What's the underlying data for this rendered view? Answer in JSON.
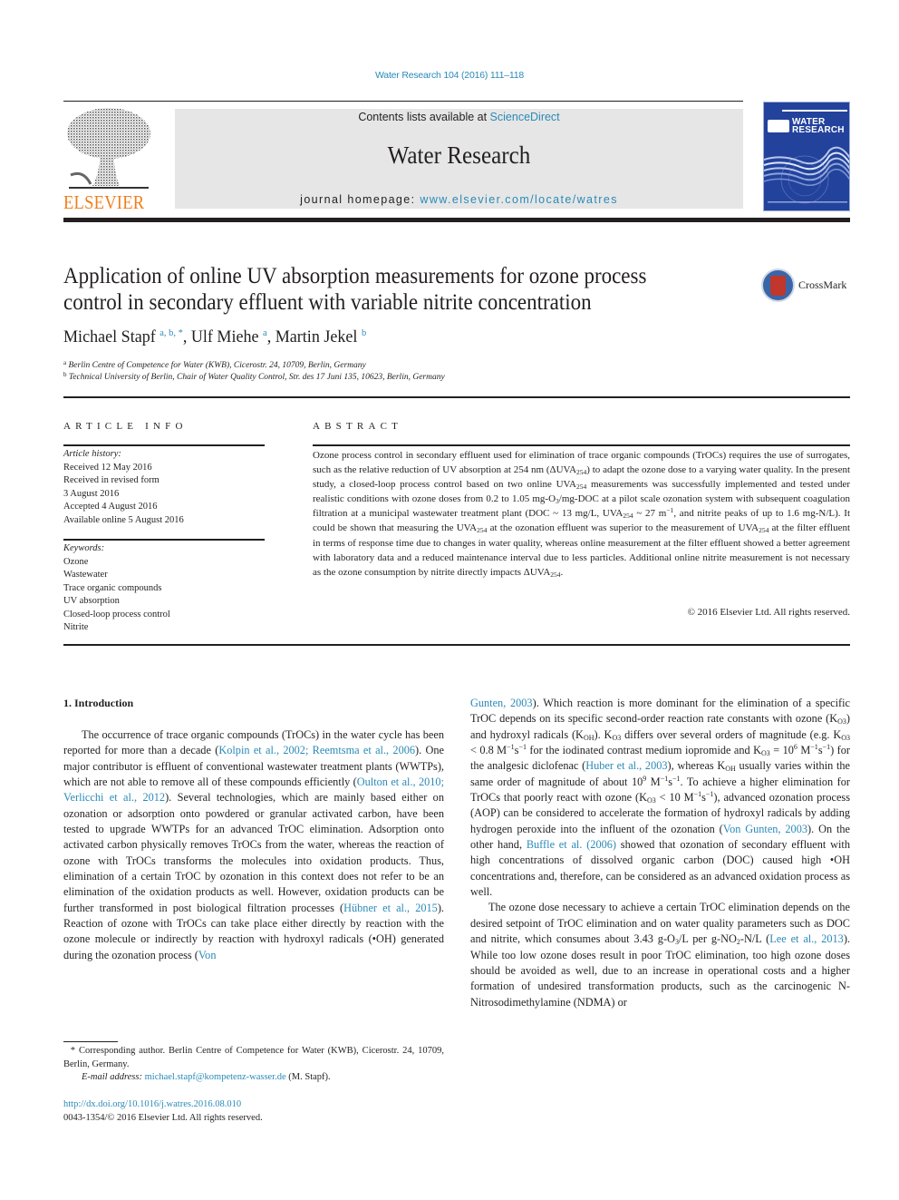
{
  "header": {
    "citation": "Water Research 104 (2016) 111–118",
    "contents_prefix": "Contents lists available at ",
    "contents_link": "ScienceDirect",
    "journal_title": "Water Research",
    "homepage_prefix": "journal homepage: ",
    "homepage_link": "www.elsevier.com/locate/watres",
    "publisher_logo": "ELSEVIER",
    "cover_title_line1": "WATER",
    "cover_title_line2": "RESEARCH",
    "colors": {
      "link": "#2a8ab8",
      "elsevier_orange": "#f07e1b",
      "cover_blue": "#23429c",
      "masthead_gray": "#e6e6e6"
    }
  },
  "article": {
    "title_line1": "Application of online UV absorption measurements for ozone process",
    "title_line2": "control in secondary effluent with variable nitrite concentration",
    "crossmark_label": "CrossMark",
    "authors": [
      {
        "name": "Michael Stapf",
        "marks": "a, b, *",
        "sep": ", "
      },
      {
        "name": "Ulf Miehe",
        "marks": "a",
        "sep": ", "
      },
      {
        "name": "Martin Jekel",
        "marks": "b",
        "sep": ""
      }
    ],
    "affiliations": [
      {
        "mark": "a",
        "text": "Berlin Centre of Competence for Water (KWB), Cicerostr. 24, 10709, Berlin, Germany"
      },
      {
        "mark": "b",
        "text": "Technical University of Berlin, Chair of Water Quality Control, Str. des 17 Juni 135, 10623, Berlin, Germany"
      }
    ]
  },
  "article_info": {
    "heading": "ARTICLE INFO",
    "history_label": "Article history:",
    "history": [
      "Received 12 May 2016",
      "Received in revised form",
      "3 August 2016",
      "Accepted 4 August 2016",
      "Available online 5 August 2016"
    ],
    "keywords_label": "Keywords:",
    "keywords": [
      "Ozone",
      "Wastewater",
      "Trace organic compounds",
      "UV absorption",
      "Closed-loop process control",
      "Nitrite"
    ]
  },
  "abstract": {
    "heading": "ABSTRACT",
    "s1": "Ozone process control in secondary effluent used for elimination of trace organic compounds (TrOCs) requires the use of surrogates, such as the relative reduction of UV absorption at 254 nm (ΔUVA",
    "sub_254": "254",
    "s2": ") to adapt the ozone dose to a varying water quality. In the present study, a closed-loop process control based on two online UVA",
    "s3": " measurements was successfully implemented and tested under realistic conditions with ozone doses from 0.2 to 1.05 mg-O",
    "sub_3": "3",
    "s4": "/mg-DOC at a pilot scale ozonation system with subsequent coagulation filtration at a municipal wastewater treatment plant (DOC ~ 13 mg/L, UVA",
    "s5": " ~ 27 m",
    "sup_minus1": "−1",
    "s6": ", and nitrite peaks of up to 1.6 mg-N/L). It could be shown that measuring the UVA",
    "s7": " at the ozonation effluent was superior to the measurement of UVA",
    "s8": " at the filter effluent in terms of response time due to changes in water quality, whereas online measurement at the filter effluent showed a better agreement with laboratory data and a reduced maintenance interval due to less particles. Additional online nitrite measurement is not necessary as the ozone consumption by nitrite directly impacts ΔUVA",
    "s9": ".",
    "copyright": "© 2016 Elsevier Ltd. All rights reserved."
  },
  "intro": {
    "heading": "1.  Introduction",
    "left": {
      "p1_a": "The occurrence of trace organic compounds (TrOCs) in the water cycle has been reported for more than a decade (",
      "ref1": "Kolpin et al., 2002; Reemtsma et al., 2006",
      "p1_b": "). One major contributor is effluent of conventional wastewater treatment plants (WWTPs), which are not able to remove all of these compounds efficiently (",
      "ref2": "Oulton et al., 2010; Verlicchi et al., 2012",
      "p1_c": "). Several technologies, which are mainly based either on ozonation or adsorption onto powdered or granular activated carbon, have been tested to upgrade WWTPs for an advanced TrOC elimination. Adsorption onto activated carbon physically removes TrOCs from the water, whereas the reaction of ozone with TrOCs transforms the molecules into oxidation products. Thus, elimination of a certain TrOC by ozonation in this context does not refer to be an elimination of the oxidation products as well. However, oxidation products can be further transformed in post biological filtration processes (",
      "ref3": "Hübner et al., 2015",
      "p1_d": "). Reaction of ozone with TrOCs can take place either directly by reaction with the ozone molecule or indirectly by reaction with hydroxyl radicals (•OH) generated during the ozonation process (",
      "ref4": "Von"
    },
    "right": {
      "ref4_cont": "Gunten, 2003",
      "p1_e": "). Which reaction is more dominant for the elimination of a specific TrOC depends on its specific second-order reaction rate constants with ozone (K",
      "sub_o3": "O3",
      "sub_oh": "OH",
      "p1_f": ") and hydroxyl radicals (K",
      "p1_g": "). K",
      "p1_h": " differs over several orders of magnitude (e.g. K",
      "p1_i": " < 0.8 M",
      "sup_m1": "−1",
      "p1_j": "s",
      "p1_k": " for the iodinated contrast medium iopromide and K",
      "p1_l": " = 10",
      "sup_6": "6",
      "p1_m": " M",
      "p1_n": ") for the analgesic diclofenac (",
      "ref5": "Huber et al., 2003",
      "p1_o": "), whereas K",
      "p1_p": " usually varies within the same order of magnitude of about 10",
      "sup_9": "9",
      "p1_q": ". To achieve a higher elimination for TrOCs that poorly react with ozone (K",
      "p1_r": " < 10 M",
      "p1_s": "), advanced ozonation process (AOP) can be considered to accelerate the formation of hydroxyl radicals by adding hydrogen peroxide into the influent of the ozonation (",
      "ref6": "Von Gunten, 2003",
      "p1_t": "). On the other hand, ",
      "ref7": "Buffle et al. (2006)",
      "p1_u": " showed that ozonation of secondary effluent with high concentrations of dissolved organic carbon (DOC) caused high •OH concentrations and, therefore, can be considered as an advanced oxidation process as well.",
      "p2_a": "The ozone dose necessary to achieve a certain TrOC elimination depends on the desired setpoint of TrOC elimination and on water quality parameters such as DOC and nitrite, which consumes about 3.43 g-O",
      "sub_3": "3",
      "p2_b": "/L per g-NO",
      "sub_2": "2",
      "p2_c": "-N/L (",
      "ref8": "Lee et al., 2013",
      "p2_d": "). While too low ozone doses result in poor TrOC elimination, too high ozone doses should be avoided as well, due to an increase in operational costs and a higher formation of undesired transformation products, such as the carcinogenic N-Nitrosodimethylamine (NDMA) or"
    }
  },
  "footnote": {
    "star": "*",
    "corresponding": " Corresponding author. Berlin Centre of Competence for Water (KWB), Cicerostr. 24, 10709, Berlin, Germany.",
    "email_label": "E-mail address: ",
    "email": "michael.stapf@kompetenz-wasser.de",
    "email_suffix": " (M. Stapf).",
    "doi": "http://dx.doi.org/10.1016/j.watres.2016.08.010",
    "issn": "0043-1354/© 2016 Elsevier Ltd. All rights reserved."
  }
}
